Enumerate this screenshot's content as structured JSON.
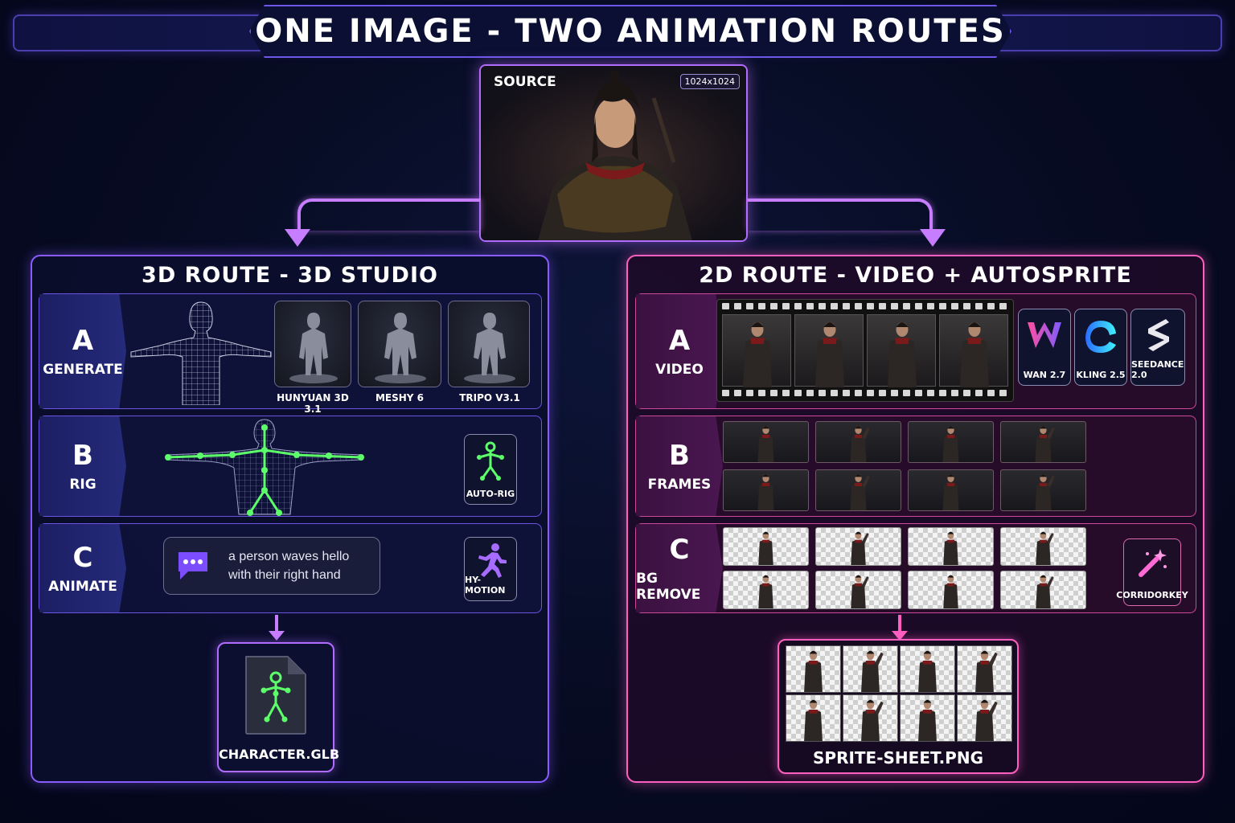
{
  "title": "ONE IMAGE - TWO ANIMATION ROUTES",
  "source": {
    "label": "SOURCE",
    "resolution": "1024x1024"
  },
  "route_3d": {
    "title": "3D ROUTE - 3D STUDIO",
    "steps": [
      {
        "letter": "A",
        "label": "GENERATE"
      },
      {
        "letter": "B",
        "label": "RIG"
      },
      {
        "letter": "C",
        "label": "ANIMATE"
      }
    ],
    "generators": [
      "HUNYUAN 3D 3.1",
      "MESHY 6",
      "TRIPO V3.1"
    ],
    "rig_tool": "AUTO-RIG",
    "prompt": "a person waves hello with their right hand",
    "motion_tool": "HY-MOTION",
    "output": "CHARACTER.GLB"
  },
  "route_2d": {
    "title": "2D ROUTE - VIDEO + AUTOSPRITE",
    "steps": [
      {
        "letter": "A",
        "label": "VIDEO"
      },
      {
        "letter": "B",
        "label": "FRAMES"
      },
      {
        "letter": "C",
        "label": "BG REMOVE"
      }
    ],
    "video_models": [
      "WAN 2.7",
      "KLING 2.5",
      "SEEDANCE 2.0"
    ],
    "bg_tool": "CORRIDORKEY",
    "output": "SPRITE-SHEET.PNG"
  },
  "colors": {
    "purple": "#8a5cff",
    "pink": "#ff5fc0",
    "green": "#5cff6a"
  }
}
